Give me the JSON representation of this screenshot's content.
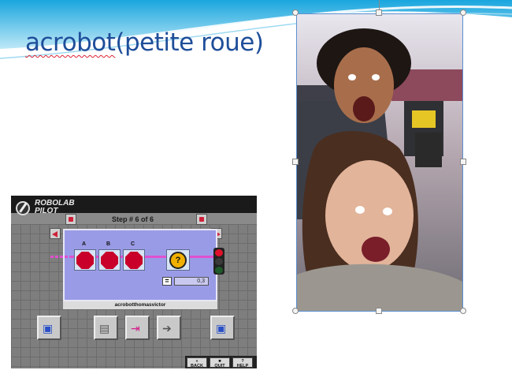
{
  "slide": {
    "title_main": "acrobot",
    "title_rest": "(petite roue)"
  },
  "robolab": {
    "logo_top": "ROBOLAB",
    "logo_bottom": "PILOT",
    "step_text": "Step # 6 of 6",
    "stop_labels": [
      "A",
      "B",
      "C"
    ],
    "sensor_symbol": "?",
    "equals_symbol": "=",
    "value": "0,3",
    "program_name": "acrobotthomasvictor",
    "footer_buttons": [
      {
        "icon": "«",
        "label": "BACK"
      },
      {
        "icon": "■",
        "label": "QUIT"
      },
      {
        "icon": "?",
        "label": "HELP"
      }
    ]
  },
  "photo": {
    "description_icon": "photo-image"
  },
  "colors": {
    "title": "#1f4e9a",
    "swoosh": "#2bb3e6",
    "canvas": "#9a9be6",
    "stop": "#c8002a",
    "wire": "#e050d0"
  }
}
